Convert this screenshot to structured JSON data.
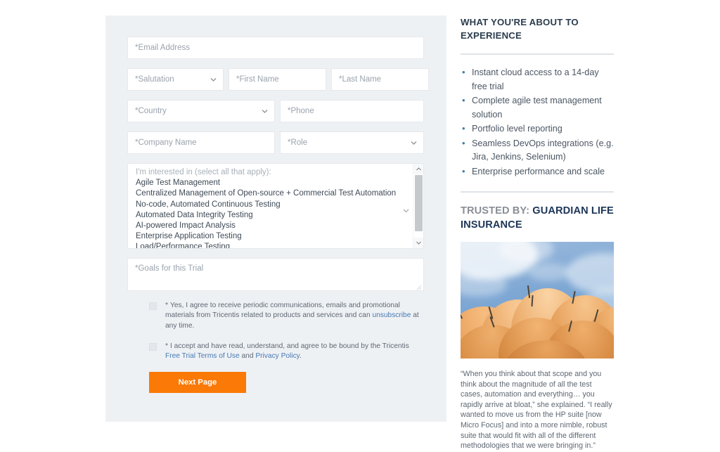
{
  "colors": {
    "panel_bg": "#eef1f4",
    "cta_orange": "#fb7906",
    "link_blue": "#4779b3",
    "bullet_blue": "#3f7fa5",
    "brand_navy": "#1d3557",
    "heading_gray": "#8a8f96"
  },
  "form": {
    "fields": {
      "email_placeholder": "*Email Address",
      "salutation_placeholder": "*Salutation",
      "first_name_placeholder": "*First Name",
      "last_name_placeholder": "*Last Name",
      "country_placeholder": "*Country",
      "phone_placeholder": "*Phone",
      "company_placeholder": "*Company Name",
      "role_placeholder": "*Role",
      "goals_placeholder": "*Goals for this Trial"
    },
    "interest_listbox": {
      "hint": "I'm interested in (select all that apply):",
      "options": [
        "Agile Test Management",
        "Centralized Management of Open-source + Commercial Test Automation",
        "No-code, Automated Continuous Testing",
        "Automated Data Integrity Testing",
        "AI-powered Impact Analysis",
        "Enterprise Application Testing",
        "Load/Performance Testing"
      ]
    },
    "consents": [
      {
        "star": "*",
        "part1": "Yes, I agree to receive periodic communications, emails and promotional materials from Tricentis related to products and services and can ",
        "link1": "unsubscribe",
        "part2": " at any time.",
        "link2": "",
        "part3": "",
        "link3": "",
        "part4": ""
      },
      {
        "star": "*",
        "part1": "I accept and have read, understand, and agree to be bound by the Tricentis ",
        "link1": "Free Trial Terms of Use",
        "part2": " and ",
        "link2": "Privacy Policy",
        "part3": ".",
        "link3": "",
        "part4": ""
      }
    ],
    "submit_label": "Next Page"
  },
  "sidebar": {
    "heading_experience": "WHAT YOU'RE ABOUT TO EXPERIENCE",
    "benefits": [
      "Instant cloud access to a 14-day free trial",
      "Complete agile test management solution",
      "Portfolio level reporting",
      "Seamless DevOps integrations (e.g. Jira, Jenkins, Selenium)",
      "Enterprise performance and scale"
    ],
    "trusted_by_label": "TRUSTED BY: ",
    "trusted_by_brand": "GUARDIAN LIFE INSURANCE",
    "photo_alt": "orange-umbrellas-photo",
    "quote": "“When you think about that scope and you think about the magnitude of all the test cases, automation and everything… you rapidly arrive at bloat,” she explained. “I really wanted to move us from the HP suite [now Micro Focus] and into a more nimble, robust suite that would fit with all of the different methodologies that we were bringing in.”"
  }
}
